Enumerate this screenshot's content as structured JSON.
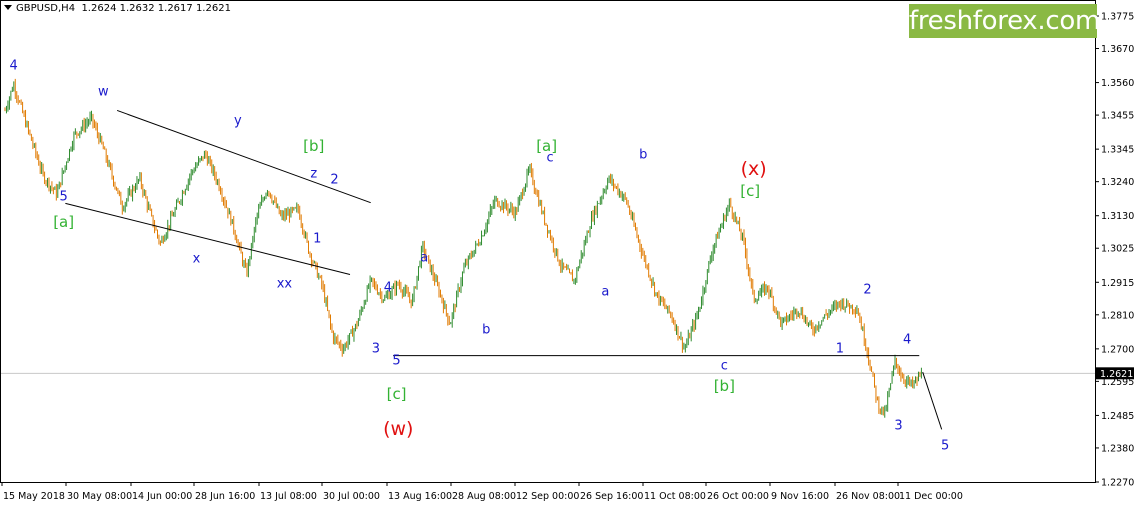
{
  "header": {
    "symbol": "GBPUSD,H4",
    "ohlc": "1.2624 1.2632 1.2617 1.2621"
  },
  "logo": {
    "text": "freshforex.com",
    "color": "#8ab944"
  },
  "colors": {
    "minor": "#1a1acc",
    "intermediate": "#33b233",
    "primary": "#e01010",
    "up_candle": "#2e8b2e",
    "down_candle": "#e07a00"
  },
  "chart_data": {
    "type": "line",
    "title": "",
    "xlabel": "",
    "ylabel": "",
    "ylim": [
      1.227,
      1.3775
    ],
    "grid": false,
    "y_ticks": [
      "1.3775",
      "1.3670",
      "1.3560",
      "1.3455",
      "1.3345",
      "1.3240",
      "1.3130",
      "1.3025",
      "1.2915",
      "1.2810",
      "1.2700",
      "1.2595",
      "1.2485",
      "1.2380",
      "1.2270"
    ],
    "x_ticks": [
      "15 May 2018",
      "30 May 08:00",
      "14 Jun 00:00",
      "28 Jun 16:00",
      "13 Jul 08:00",
      "30 Jul 00:00",
      "13 Aug 16:00",
      "28 Aug 08:00",
      "12 Sep 00:00",
      "26 Sep 16:00",
      "11 Oct 08:00",
      "26 Oct 00:00",
      "9 Nov 16:00",
      "26 Nov 08:00",
      "11 Dec 00:00"
    ],
    "current_price": {
      "label": "1.2621",
      "value": 1.2621
    },
    "series": [
      {
        "values": [
          [
            0,
            1.347
          ],
          [
            0.5,
            1.3555
          ],
          [
            1.2,
            1.343
          ],
          [
            2.2,
            1.326
          ],
          [
            3.0,
            1.32
          ],
          [
            4.0,
            1.339
          ],
          [
            5.0,
            1.3445
          ],
          [
            5.6,
            1.336
          ],
          [
            6.8,
            1.316
          ],
          [
            7.8,
            1.325
          ],
          [
            8.5,
            1.312
          ],
          [
            9.0,
            1.304
          ],
          [
            9.8,
            1.314
          ],
          [
            10.8,
            1.327
          ],
          [
            11.6,
            1.333
          ],
          [
            12.4,
            1.323
          ],
          [
            13.2,
            1.31
          ],
          [
            14.0,
            1.294
          ],
          [
            14.6,
            1.313
          ],
          [
            15.2,
            1.322
          ],
          [
            16.0,
            1.3125
          ],
          [
            17.0,
            1.315
          ],
          [
            17.6,
            1.302
          ],
          [
            18.4,
            1.29
          ],
          [
            19.0,
            1.274
          ],
          [
            19.6,
            1.27
          ],
          [
            20.4,
            1.278
          ],
          [
            21.2,
            1.292
          ],
          [
            22.0,
            1.286
          ],
          [
            22.8,
            1.291
          ],
          [
            23.6,
            1.285
          ],
          [
            24.2,
            1.303
          ],
          [
            25.2,
            1.288
          ],
          [
            25.8,
            1.278
          ],
          [
            26.6,
            1.296
          ],
          [
            27.6,
            1.306
          ],
          [
            28.4,
            1.318
          ],
          [
            29.6,
            1.314
          ],
          [
            30.4,
            1.328
          ],
          [
            31.2,
            1.313
          ],
          [
            32.2,
            1.297
          ],
          [
            33.0,
            1.292
          ],
          [
            34.0,
            1.312
          ],
          [
            35.0,
            1.325
          ],
          [
            36.0,
            1.318
          ],
          [
            37.0,
            1.3
          ],
          [
            37.8,
            1.287
          ],
          [
            38.6,
            1.281
          ],
          [
            39.4,
            1.27
          ],
          [
            40.2,
            1.282
          ],
          [
            41.0,
            1.302
          ],
          [
            42.0,
            1.317
          ],
          [
            42.8,
            1.305
          ],
          [
            43.4,
            1.286
          ],
          [
            44.2,
            1.29
          ],
          [
            45.0,
            1.278
          ],
          [
            46.0,
            1.283
          ],
          [
            46.8,
            1.276
          ],
          [
            47.6,
            1.281
          ],
          [
            48.4,
            1.285
          ],
          [
            49.4,
            1.283
          ],
          [
            50.0,
            1.269
          ],
          [
            50.6,
            1.252
          ],
          [
            51.0,
            1.249
          ],
          [
            51.6,
            1.266
          ],
          [
            52.0,
            1.261
          ],
          [
            52.6,
            1.258
          ],
          [
            53.2,
            1.2625
          ]
        ]
      }
    ],
    "trendlines": [
      {
        "name": "channel-upper",
        "from": [
          6.5,
          1.347
        ],
        "to": [
          21.2,
          1.3172
        ]
      },
      {
        "name": "channel-lower",
        "from": [
          3.5,
          1.317
        ],
        "to": [
          20.0,
          1.294
        ]
      },
      {
        "name": "support-line",
        "from": [
          22.5,
          1.2678
        ],
        "to": [
          53.0,
          1.2678
        ]
      },
      {
        "name": "projection",
        "from": [
          53.2,
          1.2625
        ],
        "to": [
          54.3,
          1.244
        ]
      }
    ],
    "annotations": [
      {
        "text": "4",
        "x": 0.5,
        "y": 1.3615,
        "level": "minor"
      },
      {
        "text": "w",
        "x": 5.7,
        "y": 1.353,
        "level": "minor"
      },
      {
        "text": "5",
        "x": 3.4,
        "y": 1.319,
        "level": "minor"
      },
      {
        "text": "[a]",
        "x": 3.4,
        "y": 1.311,
        "level": "intermediate"
      },
      {
        "text": "x",
        "x": 11.1,
        "y": 1.299,
        "level": "minor"
      },
      {
        "text": "y",
        "x": 13.5,
        "y": 1.3435,
        "level": "minor"
      },
      {
        "text": "xx",
        "x": 16.2,
        "y": 1.291,
        "level": "minor"
      },
      {
        "text": "[b]",
        "x": 17.9,
        "y": 1.3355,
        "level": "intermediate"
      },
      {
        "text": "z",
        "x": 17.9,
        "y": 1.3265,
        "level": "minor"
      },
      {
        "text": "2",
        "x": 19.1,
        "y": 1.3245,
        "level": "minor"
      },
      {
        "text": "1",
        "x": 18.1,
        "y": 1.3055,
        "level": "minor"
      },
      {
        "text": "4",
        "x": 22.2,
        "y": 1.2895,
        "level": "minor"
      },
      {
        "text": "3",
        "x": 21.5,
        "y": 1.27,
        "level": "minor"
      },
      {
        "text": "5",
        "x": 22.7,
        "y": 1.266,
        "level": "minor"
      },
      {
        "text": "[c]",
        "x": 22.7,
        "y": 1.2555,
        "level": "intermediate"
      },
      {
        "text": "(w)",
        "x": 22.8,
        "y": 1.244,
        "level": "primary"
      },
      {
        "text": "a",
        "x": 24.3,
        "y": 1.2995,
        "level": "minor"
      },
      {
        "text": "b",
        "x": 27.9,
        "y": 1.276,
        "level": "minor"
      },
      {
        "text": "[a]",
        "x": 31.4,
        "y": 1.3355,
        "level": "intermediate"
      },
      {
        "text": "c",
        "x": 31.6,
        "y": 1.3315,
        "level": "minor"
      },
      {
        "text": "b",
        "x": 37.0,
        "y": 1.3325,
        "level": "minor"
      },
      {
        "text": "a",
        "x": 34.8,
        "y": 1.2885,
        "level": "minor"
      },
      {
        "text": "(x)",
        "x": 43.4,
        "y": 1.328,
        "level": "primary"
      },
      {
        "text": "[c]",
        "x": 43.2,
        "y": 1.321,
        "level": "intermediate"
      },
      {
        "text": "c",
        "x": 41.7,
        "y": 1.2645,
        "level": "minor"
      },
      {
        "text": "[b]",
        "x": 41.7,
        "y": 1.258,
        "level": "intermediate"
      },
      {
        "text": "2",
        "x": 50.0,
        "y": 1.289,
        "level": "minor"
      },
      {
        "text": "1",
        "x": 48.4,
        "y": 1.27,
        "level": "minor"
      },
      {
        "text": "4",
        "x": 52.3,
        "y": 1.273,
        "level": "minor"
      },
      {
        "text": "3",
        "x": 51.8,
        "y": 1.245,
        "level": "minor"
      },
      {
        "text": "5",
        "x": 54.5,
        "y": 1.2385,
        "level": "minor"
      }
    ]
  }
}
